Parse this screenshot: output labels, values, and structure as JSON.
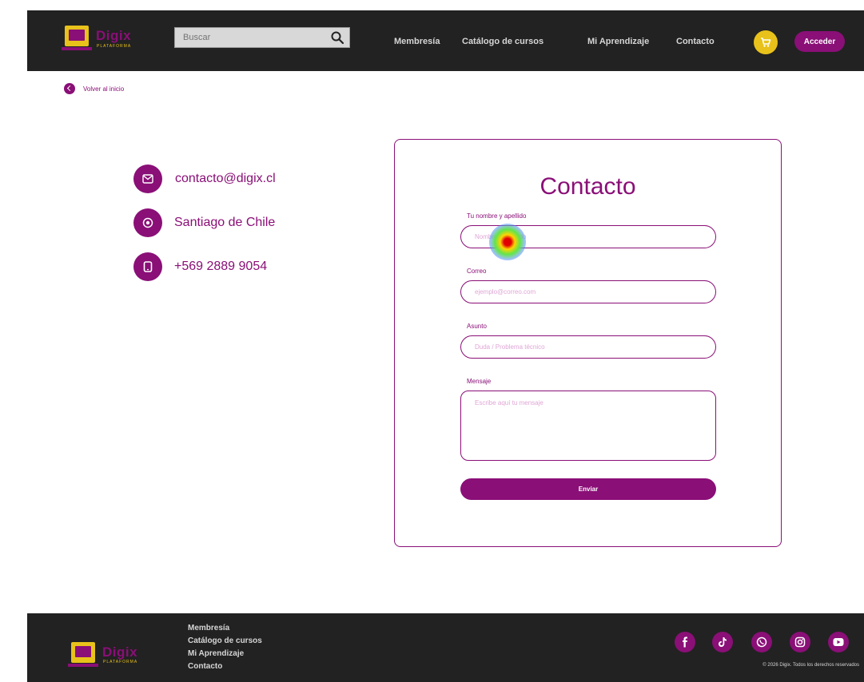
{
  "header": {
    "brand": "Digix",
    "brand_tagline": "PLATAFORMA",
    "search_placeholder": "Buscar",
    "nav": [
      "Membresía",
      "Catálogo de cursos",
      "Mi Aprendizaje",
      "Contacto"
    ],
    "login_label": "Acceder"
  },
  "back_link": "Volver al inicio",
  "contact_info": {
    "email": "contacto@digix.cl",
    "location": "Santiago de Chile",
    "phone": "+569 2889 9054"
  },
  "form": {
    "title": "Contacto",
    "name_label": "Tu nombre y apellido",
    "name_placeholder": "Nombre y apellido",
    "email_label": "Correo",
    "email_placeholder": "ejemplo@correo.com",
    "subject_label": "Asunto",
    "subject_placeholder": "Duda / Problema técnico",
    "message_label": "Mensaje",
    "message_placeholder": "Escribe aquí tu mensaje",
    "submit_label": "Enviar"
  },
  "footer": {
    "brand": "Digix",
    "links": [
      "Membresía",
      "Catálogo de cursos",
      "Mi Aprendizaje",
      "Contacto"
    ],
    "copyright": "© 2026 Digix. Todos los derechos reservados",
    "social": [
      "facebook-icon",
      "tiktok-icon",
      "whatsapp-icon",
      "instagram-icon",
      "youtube-icon"
    ]
  },
  "colors": {
    "primary": "#8a0f77",
    "accent": "#e8c21a",
    "dark": "#222222"
  }
}
